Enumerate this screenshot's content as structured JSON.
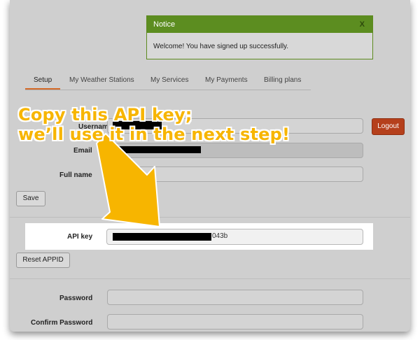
{
  "notice": {
    "title": "Notice",
    "close": "X",
    "message": "Welcome! You have signed up successfully."
  },
  "tabs": [
    {
      "label": "Setup"
    },
    {
      "label": "My Weather Stations"
    },
    {
      "label": "My Services"
    },
    {
      "label": "My Payments"
    },
    {
      "label": "Billing plans"
    }
  ],
  "logout_label": "Logout",
  "fields": {
    "username_label": "Username",
    "email_label": "Email",
    "fullname_label": "Full name",
    "apikey_label": "API key",
    "apikey_suffix": "043b",
    "password_label": "Password",
    "confirm_password_label": "Confirm Password"
  },
  "buttons": {
    "save": "Save",
    "reset": "Reset APPID"
  },
  "overlay": {
    "line1": "Copy this API key;",
    "line2": "we’ll use it in the next step!"
  },
  "colors": {
    "notice_green": "#5c8d20",
    "logout_red": "#b5401c",
    "tab_accent": "#d46a28",
    "annotation_yellow": "#f7b500"
  }
}
